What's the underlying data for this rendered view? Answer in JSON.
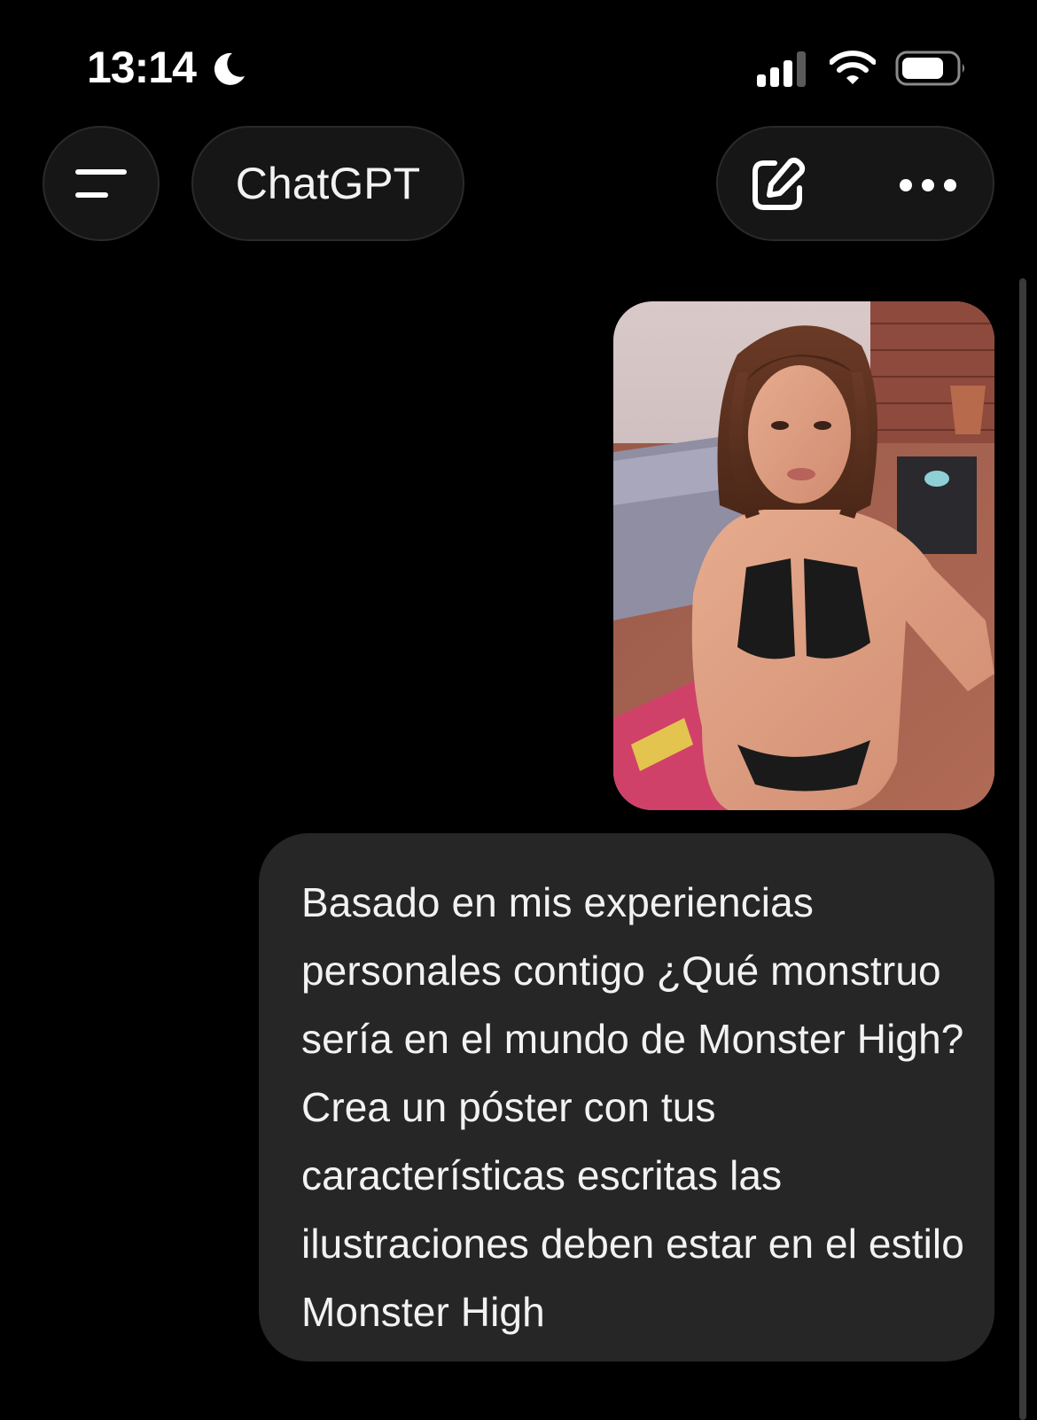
{
  "status_bar": {
    "time": "13:14",
    "icons": [
      "moon-icon",
      "signal-icon",
      "wifi-icon",
      "battery-icon"
    ]
  },
  "header": {
    "menu_icon": "menu-icon",
    "title": "ChatGPT",
    "new_chat_icon": "new-chat-icon",
    "more_icon": "more-icon"
  },
  "conversation": {
    "user_message": {
      "attachment": {
        "type": "photo",
        "icon": "photo-thumbnail"
      },
      "text": "Basado en mis experiencias personales contigo ¿Qué monstruo sería en el mundo de Monster High? Crea un póster con tus características escritas las ilustraciones deben estar en el estilo Monster High"
    }
  },
  "colors": {
    "background": "#000000",
    "bubble": "#262626",
    "pill": "#161616",
    "text": "#f2f2f2"
  }
}
